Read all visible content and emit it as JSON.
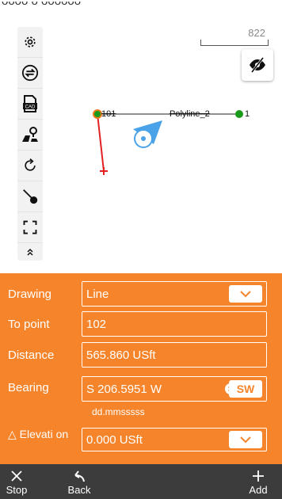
{
  "map": {
    "scale_label": "822",
    "point_101_label": "101",
    "point_1_label": "1",
    "polyline_label": "Polyline_2"
  },
  "toolbar": {
    "icons": [
      "gear-icon",
      "swap-icon",
      "cad-icon",
      "map-pin-icon",
      "rotate-icon",
      "stakeout-line-icon",
      "fullscreen-icon",
      "chevron-up-double-icon"
    ]
  },
  "form": {
    "drawing_label": "Drawing",
    "drawing_value": "Line",
    "to_point_label": "To point",
    "to_point_value": "102",
    "distance_label": "Distance",
    "distance_value": "565.860 USft",
    "bearing_label": "Bearing",
    "bearing_value": "S 206.5951 W",
    "bearing_quadrant": "SW",
    "bearing_hint": "dd.mmsssss",
    "elevation_label": "△ Elevati on",
    "elevation_value": "0.000 USft"
  },
  "bottom_bar": {
    "stop_label": "Stop",
    "back_label": "Back",
    "add_label": "Add"
  },
  "colors": {
    "panel_orange": "#f5842a",
    "bottom_bar": "#3c3c3c",
    "line_red": "#e22222",
    "point_green": "#1a9a1a",
    "location_blue": "#4aa3e8"
  }
}
